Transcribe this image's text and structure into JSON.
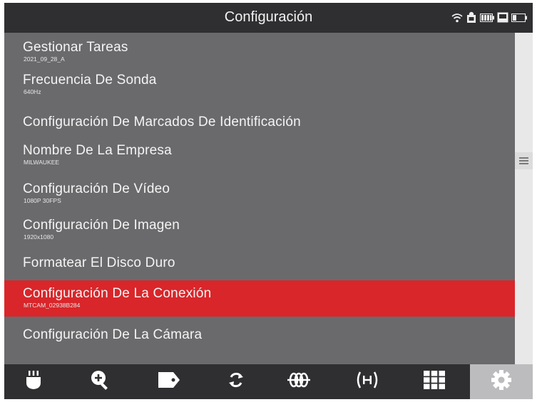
{
  "header": {
    "title": "Configuración",
    "status_icons": [
      "wifi-icon",
      "recording-icon",
      "battery-icon",
      "storage-icon",
      "screen-battery-icon"
    ]
  },
  "menu": {
    "items": [
      {
        "label": "Gestionar Tareas",
        "sub": "2021_09_28_A",
        "selected": false
      },
      {
        "label": "Frecuencia De Sonda",
        "sub": "640Hz",
        "selected": false
      },
      {
        "label": "Configuración De Marcados De Identificación",
        "sub": "",
        "selected": false
      },
      {
        "label": "Nombre De La Empresa",
        "sub": "MILWAUKEE",
        "selected": false
      },
      {
        "label": "Configuración De Vídeo",
        "sub": "1080P 30FPS",
        "selected": false
      },
      {
        "label": "Configuración De Imagen",
        "sub": "1920x1080",
        "selected": false
      },
      {
        "label": "Formatear El Disco Duro",
        "sub": "",
        "selected": false
      },
      {
        "label": "Configuración De La Conexión",
        "sub": "MTCAM_02938B284",
        "selected": true
      },
      {
        "label": "Configuración De La Cámara",
        "sub": "",
        "selected": false
      }
    ]
  },
  "toolbar": {
    "tools": [
      "sonde-icon",
      "zoom-in-icon",
      "tag-icon",
      "rotate-icon",
      "locator-icon",
      "signal-icon",
      "grid-icon",
      "gear-icon"
    ],
    "active": "gear-icon"
  },
  "colors": {
    "background": "#6a6a6d",
    "header": "#2f2f32",
    "selected": "#d9262a",
    "text": "#f4f4f4"
  }
}
